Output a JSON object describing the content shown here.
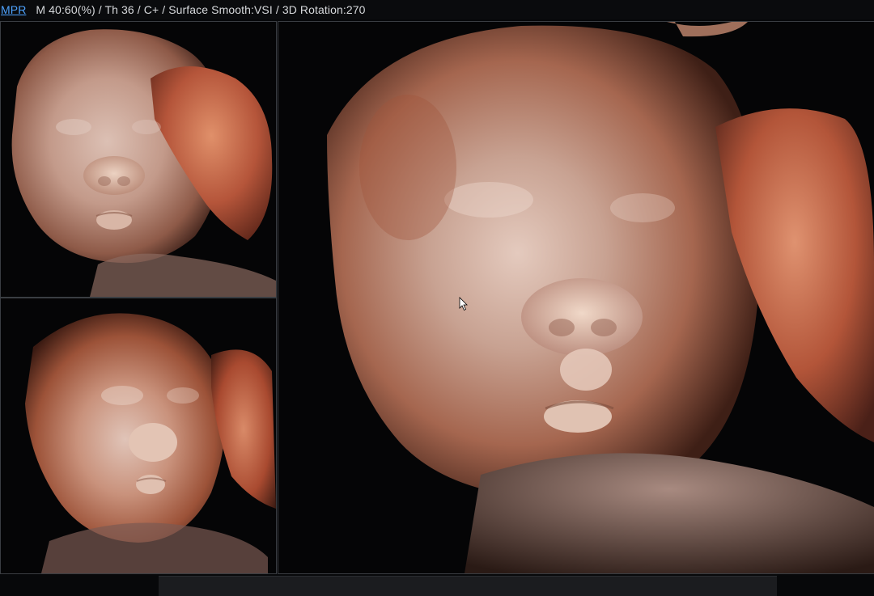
{
  "header": {
    "mode": "MPR",
    "params": "M 40:60(%) / Th 36 / C+ / Surface Smooth:VSI / 3D Rotation:270"
  },
  "panels": [
    {
      "name": "top-left-render",
      "icon": "fetal-face-render-view-1"
    },
    {
      "name": "bottom-left-render",
      "icon": "fetal-face-render-view-2"
    },
    {
      "name": "main-render",
      "icon": "fetal-face-render-main"
    }
  ],
  "colors": {
    "accent": "#4ea3ff",
    "skin_light": "#e6c6b6",
    "skin_mid": "#c08a74",
    "skin_deep": "#8c3f2a",
    "background": "#07080a"
  }
}
